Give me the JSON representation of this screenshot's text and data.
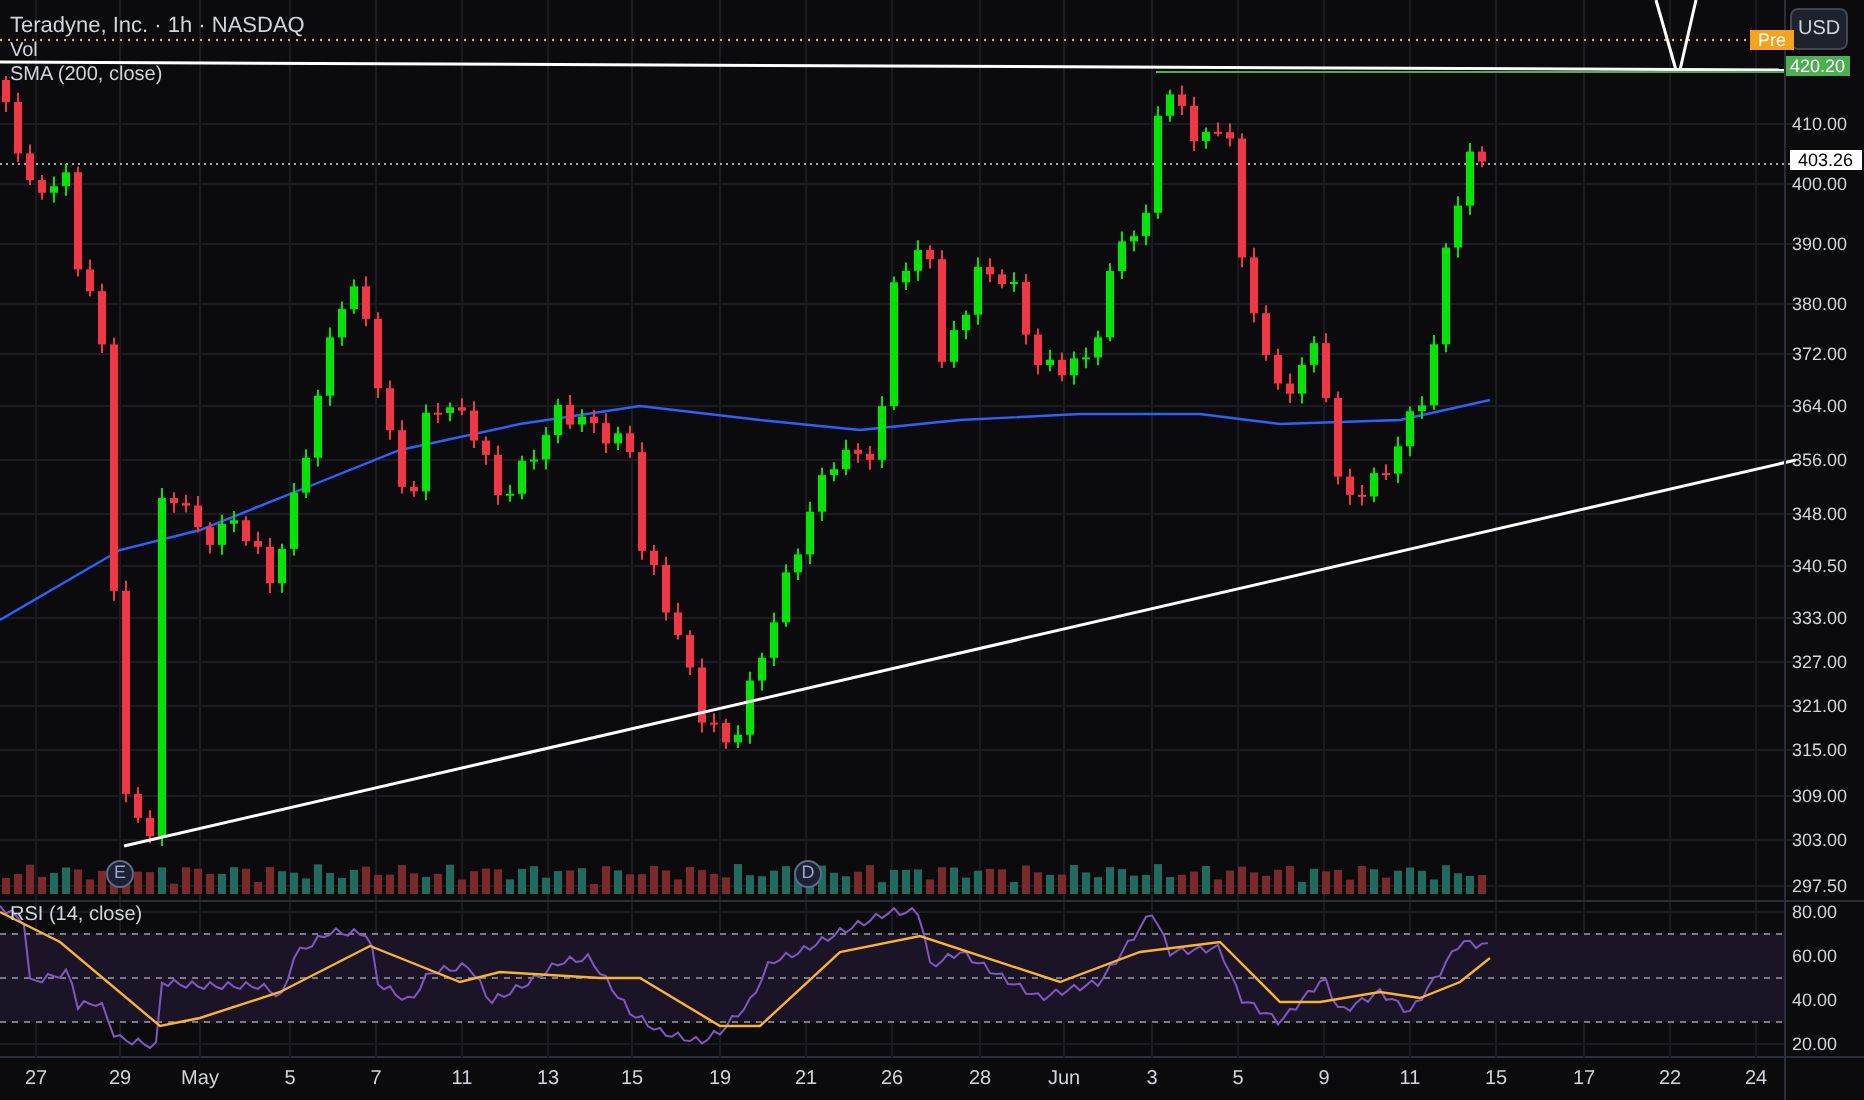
{
  "legend": {
    "title": "Teradyne, Inc. · 1h · NASDAQ",
    "indicators": [
      "Vol",
      "SMA (200, close)"
    ]
  },
  "price_axis": {
    "currency": "USD",
    "ticks": [
      "410.00",
      "400.00",
      "390.00",
      "380.00",
      "372.00",
      "364.00",
      "356.00",
      "348.00",
      "340.50",
      "333.00",
      "327.00",
      "321.00",
      "315.00",
      "309.00",
      "303.00",
      "297.50"
    ]
  },
  "badges": [
    {
      "kind": "pre",
      "text": "Pre"
    },
    {
      "kind": "last",
      "text": "420.20"
    },
    {
      "kind": "current",
      "text": "403.26"
    }
  ],
  "events": [
    {
      "text": "E"
    },
    {
      "text": "D"
    }
  ],
  "rsi": {
    "label": "RSI (14, close)",
    "ticks": [
      "80.00",
      "60.00",
      "40.00",
      "20.00"
    ]
  },
  "time_axis": {
    "ticks": [
      "27",
      "29",
      "May",
      "5",
      "7",
      "11",
      "13",
      "15",
      "19",
      "21",
      "26",
      "28",
      "Jun",
      "3",
      "5",
      "9",
      "11",
      "15",
      "17",
      "22",
      "24"
    ]
  }
}
